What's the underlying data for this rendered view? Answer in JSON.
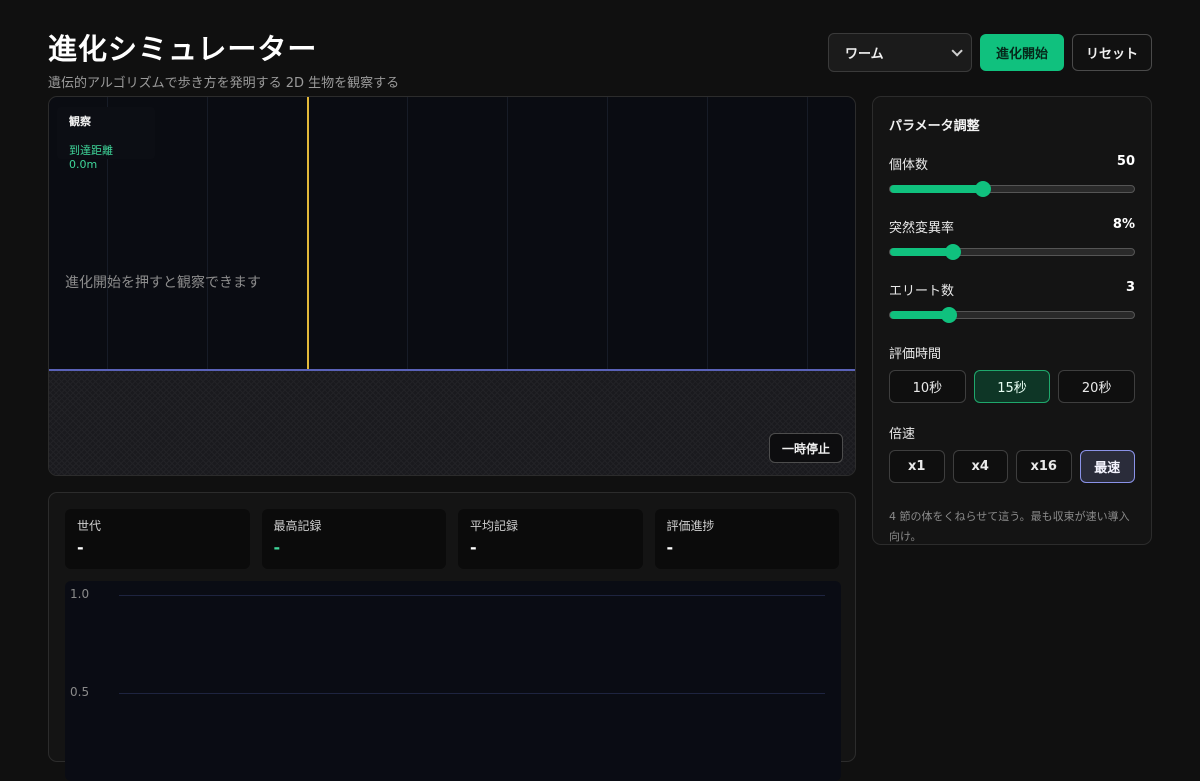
{
  "header": {
    "title": "進化シミュレーター",
    "subtitle": "遺伝的アルゴリズムで歩き方を発明する 2D 生物を観察する"
  },
  "toolbar": {
    "creature_select": "ワーム",
    "start_label": "進化開始",
    "reset_label": "リセット"
  },
  "simulation": {
    "observe_title": "観察",
    "distance_label": "到達距離 0.0m",
    "hint": "進化開始を押すと観察できます",
    "pause_label": "一時停止",
    "accent_color": "#e2b93a",
    "ground_color": "#5a62b8"
  },
  "stats": {
    "cards": [
      {
        "label": "世代",
        "value": "-"
      },
      {
        "label": "最高記録",
        "value": "-"
      },
      {
        "label": "平均記録",
        "value": "-"
      },
      {
        "label": "評価進捗",
        "value": "-"
      }
    ],
    "chart_ticks": [
      "1.0",
      "0.5"
    ]
  },
  "params": {
    "title": "パラメータ調整",
    "population": {
      "label": "個体数",
      "value": "50",
      "fraction": 0.38
    },
    "mutation": {
      "label": "突然変異率",
      "value": "8%",
      "fraction": 0.26
    },
    "elite": {
      "label": "エリート数",
      "value": "3",
      "fraction": 0.24
    },
    "eval_time": {
      "label": "評価時間",
      "options": [
        "10秒",
        "15秒",
        "20秒"
      ],
      "selected": "15秒"
    },
    "speed": {
      "label": "倍速",
      "options": [
        "x1",
        "x4",
        "x16",
        "最速"
      ],
      "selected": "最速"
    },
    "note": "4 節の体をくねらせて這う。最も収束が速い導入向け。"
  },
  "colors": {
    "accent": "#10c17e",
    "selected_speed": "#8a92e8"
  }
}
